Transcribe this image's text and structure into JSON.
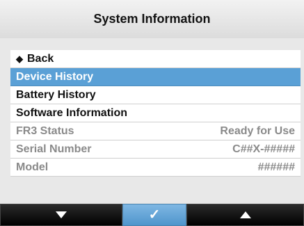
{
  "header": {
    "title": "System Information"
  },
  "menu": {
    "back_label": "Back",
    "items": [
      {
        "label": "Device History"
      },
      {
        "label": "Battery History"
      },
      {
        "label": "Software Information"
      }
    ],
    "info": [
      {
        "label": "FR3 Status",
        "value": "Ready for Use"
      },
      {
        "label": "Serial Number",
        "value": "C##X-#####"
      },
      {
        "label": "Model",
        "value": "######"
      }
    ]
  },
  "footer": {
    "left_icon": "down-arrow-icon",
    "center_icon": "check-icon",
    "right_icon": "up-arrow-icon"
  },
  "colors": {
    "selected_row": "#5aa0d6",
    "center_button": "#4f95cc",
    "side_buttons": "#000000"
  }
}
